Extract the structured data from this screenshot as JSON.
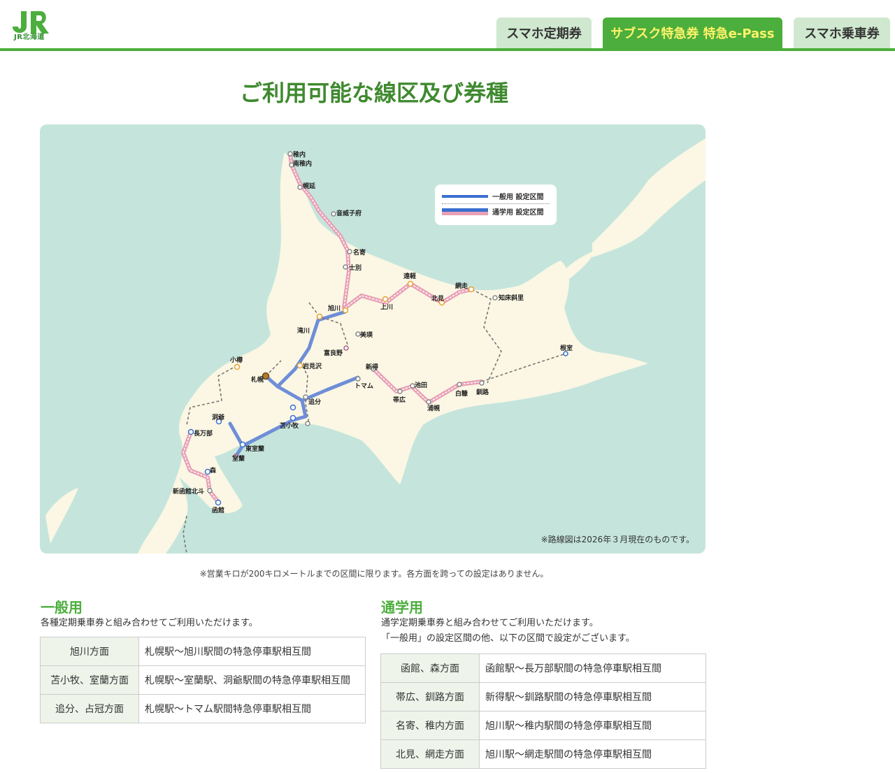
{
  "header": {
    "logo_text": "JR北海道",
    "tabs": [
      {
        "label": "スマホ定期券",
        "active": false
      },
      {
        "label": "サブスク特急券 特急e-Pass",
        "active": true
      },
      {
        "label": "スマホ乗車券",
        "active": false
      }
    ],
    "accent_color": "#4cae3c"
  },
  "page_title": "ご利用可能な線区及び券種",
  "map": {
    "legend": {
      "general": "一般用 設定区間",
      "commuter": "通学用 設定区間"
    },
    "note": "※路線図は2026年３月現在のものです。",
    "stations": [
      "稚内",
      "南稚内",
      "幌延",
      "音威子府",
      "名寄",
      "士別",
      "旭川",
      "上川",
      "遠軽",
      "北見",
      "網走",
      "知床斜里",
      "美瑛",
      "滝川",
      "富良野",
      "小樽",
      "札幌",
      "岩見沢",
      "新得",
      "トマム",
      "帯広",
      "池田",
      "浦幌",
      "白糠",
      "釧路",
      "根室",
      "追分",
      "苫小牧",
      "洞爺",
      "長万部",
      "東室蘭",
      "室蘭",
      "森",
      "新函館北斗",
      "函館"
    ]
  },
  "footnote": "※営業キロが200キロメートルまでの区間に限ります。各方面を跨っての設定はありません。",
  "general": {
    "title": "一般用",
    "desc": "各種定期乗車券と組み合わせてご利用いただけます。",
    "rows": [
      {
        "dir": "旭川方面",
        "val": "札幌駅〜旭川駅間の特急停車駅相互間"
      },
      {
        "dir": "苫小牧、室蘭方面",
        "val": "札幌駅〜室蘭駅、洞爺駅間の特急停車駅相互間"
      },
      {
        "dir": "追分、占冠方面",
        "val": "札幌駅〜トマム駅間特急停車駅相互間"
      }
    ]
  },
  "commuter": {
    "title": "通学用",
    "desc1": "通学定期乗車券と組み合わせてご利用いただけます。",
    "desc2": "「一般用」の設定区間の他、以下の区間で設定がございます。",
    "rows": [
      {
        "dir": "函館、森方面",
        "val": "函館駅〜長万部駅間の特急停車駅相互間"
      },
      {
        "dir": "帯広、釧路方面",
        "val": "新得駅〜釧路駅間の特急停車駅相互間"
      },
      {
        "dir": "名寄、稚内方面",
        "val": "旭川駅〜稚内駅間の特急停車駅相互間"
      },
      {
        "dir": "北見、網走方面",
        "val": "旭川駅〜網走駅間の特急停車駅相互間"
      }
    ]
  }
}
